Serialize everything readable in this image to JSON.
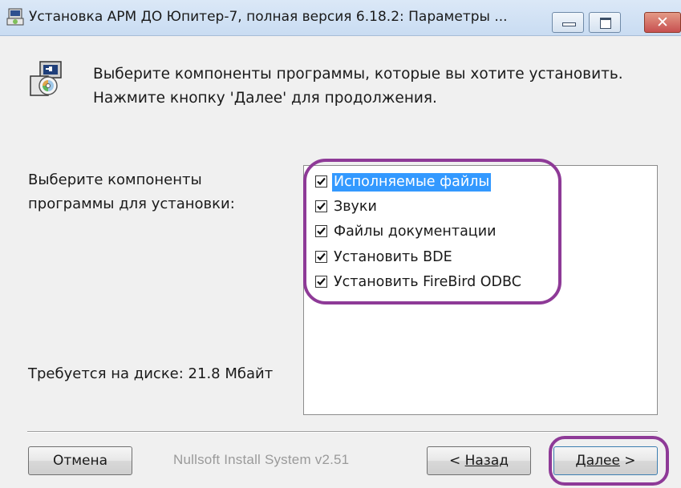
{
  "window": {
    "title": "Установка АРМ ДО Юпитер-7, полная версия 6.18.2: Параметры ...",
    "controls": {
      "minimize": "minimize",
      "maximize": "maximize",
      "close": "close"
    }
  },
  "header": {
    "line1": "Выберите компоненты программы, которые вы хотите установить.",
    "line2": "Нажмите кнопку 'Далее' для продолжения."
  },
  "components": {
    "label_line1": "Выберите компоненты",
    "label_line2": "программы для установки:",
    "items": [
      {
        "label": "Исполняемые файлы",
        "checked": true,
        "selected": true
      },
      {
        "label": "Звуки",
        "checked": true,
        "selected": false
      },
      {
        "label": "Файлы документации",
        "checked": true,
        "selected": false
      },
      {
        "label": "Установить BDE",
        "checked": true,
        "selected": false
      },
      {
        "label": "Установить FireBird ODBC",
        "checked": true,
        "selected": false
      }
    ]
  },
  "disk": {
    "label": "Требуется на диске: 21.8 Мбайт"
  },
  "footer": {
    "branding": "Nullsoft Install System v2.51",
    "cancel_label": "Отмена",
    "back_prefix": "< ",
    "back_label": "Назад",
    "next_label": "Далее",
    "next_suffix": " >"
  },
  "colors": {
    "selection": "#3399ff",
    "annotation": "#8e3a97"
  }
}
